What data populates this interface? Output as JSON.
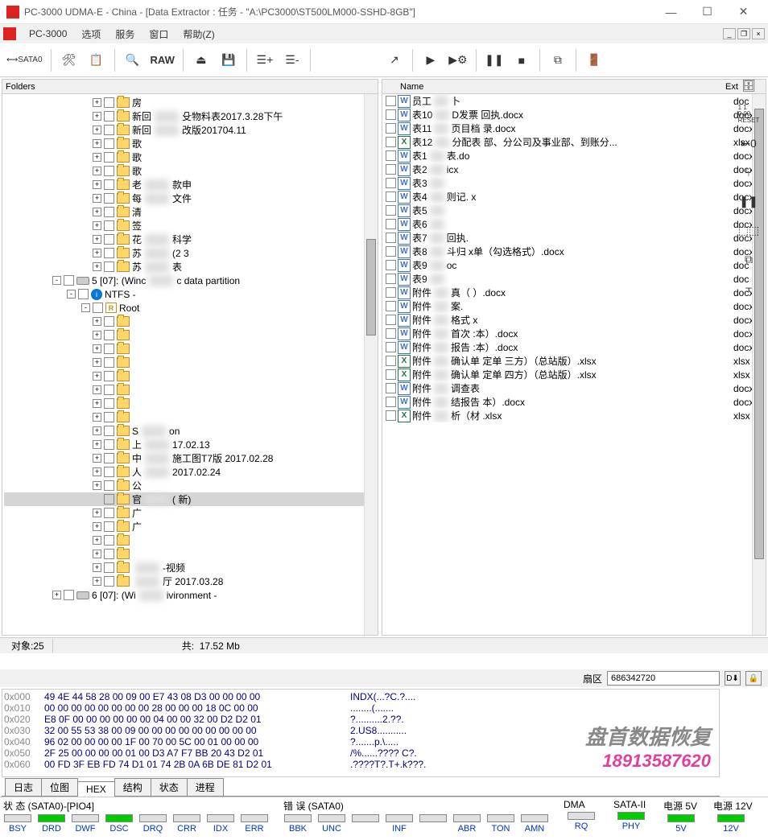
{
  "window": {
    "title": "PC-3000 UDMA-E - China - [Data Extractor : 任务 - \"A:\\PC3000\\ST500LM000-SSHD-8GB\"]",
    "app_name": "PC-3000"
  },
  "menu": {
    "items": [
      "选项",
      "服务",
      "窗口",
      "帮助(Z)"
    ]
  },
  "toolbar": {
    "sata_label": "SATA0",
    "raw_label": "RAW"
  },
  "left_panel": {
    "header": "Folders",
    "tree": [
      {
        "indent": 110,
        "exp": "+",
        "type": "folder",
        "label": "房"
      },
      {
        "indent": 110,
        "exp": "+",
        "type": "folder",
        "label": "新回",
        "suffix": "殳物料表2017.3.28下午"
      },
      {
        "indent": 110,
        "exp": "+",
        "type": "folder",
        "label": "新回",
        "suffix": "改版201704.11"
      },
      {
        "indent": 110,
        "exp": "+",
        "type": "folder",
        "label": "歌"
      },
      {
        "indent": 110,
        "exp": "+",
        "type": "folder",
        "label": "歌"
      },
      {
        "indent": 110,
        "exp": "+",
        "type": "folder",
        "label": "歌"
      },
      {
        "indent": 110,
        "exp": "+",
        "type": "folder",
        "label": "老",
        "suffix": "款申"
      },
      {
        "indent": 110,
        "exp": "+",
        "type": "folder",
        "label": "每",
        "suffix": "文件"
      },
      {
        "indent": 110,
        "exp": "+",
        "type": "folder",
        "label": "清"
      },
      {
        "indent": 110,
        "exp": "+",
        "type": "folder",
        "label": "签"
      },
      {
        "indent": 110,
        "exp": "+",
        "type": "folder",
        "label": "花",
        "suffix": "科学"
      },
      {
        "indent": 110,
        "exp": "+",
        "type": "folder",
        "label": "苏",
        "suffix": "(2        3"
      },
      {
        "indent": 110,
        "exp": "+",
        "type": "folder",
        "label": "苏",
        "suffix": "表"
      },
      {
        "indent": 60,
        "exp": "-",
        "type": "part",
        "label": "5 [07]: (Winc",
        "suffix": "c data partition"
      },
      {
        "indent": 78,
        "exp": "-",
        "type": "ntfs",
        "label": "NTFS -"
      },
      {
        "indent": 96,
        "exp": "-",
        "type": "root",
        "label": "Root"
      },
      {
        "indent": 110,
        "exp": "+",
        "type": "folder",
        "label": ""
      },
      {
        "indent": 110,
        "exp": "+",
        "type": "folder",
        "label": ""
      },
      {
        "indent": 110,
        "exp": "+",
        "type": "folder",
        "label": ""
      },
      {
        "indent": 110,
        "exp": "+",
        "type": "folder",
        "label": ""
      },
      {
        "indent": 110,
        "exp": "+",
        "type": "folder",
        "label": ""
      },
      {
        "indent": 110,
        "exp": "+",
        "type": "folder",
        "label": ""
      },
      {
        "indent": 110,
        "exp": "+",
        "type": "folder",
        "label": ""
      },
      {
        "indent": 110,
        "exp": "+",
        "type": "folder",
        "label": ""
      },
      {
        "indent": 110,
        "exp": "+",
        "type": "folder",
        "label": "S",
        "suffix": "on"
      },
      {
        "indent": 110,
        "exp": "+",
        "type": "folder",
        "label": "上",
        "suffix": "17.02.13"
      },
      {
        "indent": 110,
        "exp": "+",
        "type": "folder",
        "label": "中",
        "suffix": "施工图T7版  2017.02.28"
      },
      {
        "indent": 110,
        "exp": "+",
        "type": "folder",
        "label": "人",
        "suffix": "2017.02.24"
      },
      {
        "indent": 110,
        "exp": "+",
        "type": "folder",
        "label": "公"
      },
      {
        "indent": 110,
        "exp": "",
        "type": "folder",
        "label": "官",
        "suffix": "(     新)",
        "selected": true
      },
      {
        "indent": 110,
        "exp": "+",
        "type": "folder",
        "label": "广"
      },
      {
        "indent": 110,
        "exp": "+",
        "type": "folder",
        "label": "广"
      },
      {
        "indent": 110,
        "exp": "+",
        "type": "folder",
        "label": ""
      },
      {
        "indent": 110,
        "exp": "+",
        "type": "folder",
        "label": ""
      },
      {
        "indent": 110,
        "exp": "+",
        "type": "folder",
        "label": "",
        "suffix": "-视频"
      },
      {
        "indent": 110,
        "exp": "+",
        "type": "folder",
        "label": "",
        "suffix": "厅 2017.03.28"
      },
      {
        "indent": 60,
        "exp": "+",
        "type": "part",
        "label": "6 [07]: (Wi",
        "suffix": "ivironment -"
      }
    ]
  },
  "right_panel": {
    "headers": {
      "name": "Name",
      "ext": "Ext"
    },
    "files": [
      {
        "icon": "w",
        "name": "员工",
        "suffix": "卜",
        "ext": "doc"
      },
      {
        "icon": "w",
        "name": "表10",
        "suffix": "D发票      回执.docx",
        "ext": "docx"
      },
      {
        "icon": "w",
        "name": "表11",
        "suffix": "页目档     录.docx",
        "ext": "docx"
      },
      {
        "icon": "x",
        "name": "表12",
        "suffix": "分配表     部、分公司及事业部、到账分...",
        "ext": "xlsx"
      },
      {
        "icon": "w",
        "name": "表1",
        "suffix": "表.do",
        "ext": "docx"
      },
      {
        "icon": "w",
        "name": "表2",
        "suffix": "icx",
        "ext": "docx"
      },
      {
        "icon": "w",
        "name": "表3",
        "suffix": "",
        "ext": "docx"
      },
      {
        "icon": "w",
        "name": "表4",
        "suffix": "则记.     x",
        "ext": "docx"
      },
      {
        "icon": "w",
        "name": "表5",
        "suffix": "",
        "ext": "docx"
      },
      {
        "icon": "w",
        "name": "表6",
        "suffix": "",
        "ext": "docx"
      },
      {
        "icon": "w",
        "name": "表7",
        "suffix": "回执.",
        "ext": "docx"
      },
      {
        "icon": "w",
        "name": "表8",
        "suffix": "斗归      x单（勾选格式）.docx",
        "ext": "docx"
      },
      {
        "icon": "w",
        "name": "表9",
        "suffix": "oc",
        "ext": "doc"
      },
      {
        "icon": "w",
        "name": "表9",
        "suffix": "",
        "ext": "doc"
      },
      {
        "icon": "w",
        "name": "附件",
        "suffix": "真（     ）.docx",
        "ext": "docx"
      },
      {
        "icon": "w",
        "name": "附件",
        "suffix": "案.",
        "ext": "docx"
      },
      {
        "icon": "w",
        "name": "附件",
        "suffix": "格式     x",
        "ext": "docx"
      },
      {
        "icon": "w",
        "name": "附件",
        "suffix": "首次      :本）.docx",
        "ext": "docx"
      },
      {
        "icon": "w",
        "name": "附件",
        "suffix": "报告      :本）.docx",
        "ext": "docx"
      },
      {
        "icon": "x",
        "name": "附件",
        "suffix": "确认单     定单 三方）（总站版）.xlsx",
        "ext": "xlsx"
      },
      {
        "icon": "x",
        "name": "附件",
        "suffix": "确认单     定单 四方）（总站版）.xlsx",
        "ext": "xlsx"
      },
      {
        "icon": "w",
        "name": "附件",
        "suffix": "调查表",
        "ext": "docx"
      },
      {
        "icon": "w",
        "name": "附件",
        "suffix": "结报告     本）.docx",
        "ext": "docx"
      },
      {
        "icon": "x",
        "name": "附件",
        "suffix": "析（材     .xlsx",
        "ext": "xlsx"
      }
    ]
  },
  "statusbar": {
    "objects_label": "对象:",
    "objects_value": "25",
    "total_label": "共:",
    "total_value": "17.52 Mb"
  },
  "sector": {
    "label": "扇区",
    "value": "686342720"
  },
  "hex": {
    "rows": [
      {
        "addr": "0x000",
        "bytes": "49 4E 44 58 28 00 09 00 E7 43 08 D3 00 00 00 00",
        "ascii": "INDX(...?C.?...."
      },
      {
        "addr": "0x010",
        "bytes": "00 00 00 00 00 00 00 00 28 00 00 00 18 0C 00 00",
        "ascii": "........(......."
      },
      {
        "addr": "0x020",
        "bytes": "E8 0F 00 00 00 00 00 00 04 00 00 32 00 D2 D2 01",
        "ascii": "?..........2.??."
      },
      {
        "addr": "0x030",
        "bytes": "32 00 55 53 38 00 09 00 00 00 00 00 00 00 00 00",
        "ascii": "2.US8..........."
      },
      {
        "addr": "0x040",
        "bytes": "96 02 00 00 00 00 1F 00 70 00 5C 00 01 00 00 00",
        "ascii": "?.......p.\\....."
      },
      {
        "addr": "0x050",
        "bytes": "2F 25 00 00 00 00 01 00 D3 A7 F7 BB 20 43 D2 01",
        "ascii": "/%......???? C?."
      },
      {
        "addr": "0x060",
        "bytes": "00 FD 3F EB FD 74 D1 01 74 2B 0A 6B DE 81 D2 01",
        "ascii": ".????T?.T+.k???."
      }
    ]
  },
  "tabs": {
    "items": [
      "日志",
      "位图",
      "HEX",
      "结构",
      "状态",
      "进程"
    ],
    "active": 2
  },
  "bottom": {
    "status_group": "状 态 (SATA0)-[PIO4]",
    "status_leds": [
      {
        "name": "BSY",
        "on": false
      },
      {
        "name": "DRD",
        "on": true
      },
      {
        "name": "DWF",
        "on": false
      },
      {
        "name": "DSC",
        "on": true
      },
      {
        "name": "DRQ",
        "on": false
      },
      {
        "name": "CRR",
        "on": false
      },
      {
        "name": "IDX",
        "on": false
      },
      {
        "name": "ERR",
        "on": false
      }
    ],
    "error_group": "错 误 (SATA0)",
    "error_leds": [
      {
        "name": "BBK",
        "on": false
      },
      {
        "name": "UNC",
        "on": false
      },
      {
        "name": "",
        "on": false
      },
      {
        "name": "INF",
        "on": false
      },
      {
        "name": "",
        "on": false
      },
      {
        "name": "ABR",
        "on": false
      },
      {
        "name": "TON",
        "on": false
      },
      {
        "name": "AMN",
        "on": false
      }
    ],
    "dma_group": "DMA",
    "dma_leds": [
      {
        "name": "RQ",
        "on": false
      }
    ],
    "sata2_group": "SATA-II",
    "sata2_leds": [
      {
        "name": "PHY",
        "on": true
      }
    ],
    "pwr5_group": "电源 5V",
    "pwr5_leds": [
      {
        "name": "5V",
        "on": true
      }
    ],
    "pwr12_group": "电源 12V",
    "pwr12_leds": [
      {
        "name": "12V",
        "on": true
      }
    ]
  },
  "watermark": {
    "line1": "盘首数据恢复",
    "line2": "18913587620"
  }
}
